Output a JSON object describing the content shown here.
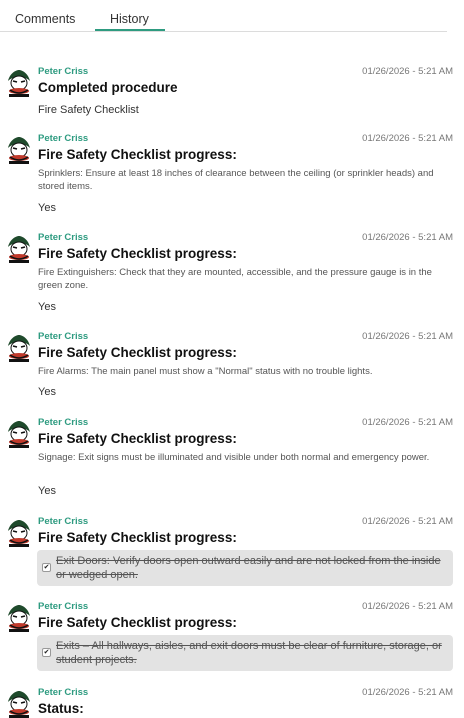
{
  "tabs": {
    "comments": "Comments",
    "history": "History"
  },
  "entries": [
    {
      "author": "Peter Criss",
      "time": "01/26/2026 - 5:21 AM",
      "title": "Completed procedure",
      "subtitle": "Fire Safety Checklist"
    },
    {
      "author": "Peter Criss",
      "time": "01/26/2026 - 5:21 AM",
      "title": "Fire Safety Checklist progress:",
      "detail": "Sprinklers: Ensure at least 18 inches of clearance between the ceiling (or sprinkler heads) and stored items.",
      "answer": "Yes"
    },
    {
      "author": "Peter Criss",
      "time": "01/26/2026 - 5:21 AM",
      "title": "Fire Safety Checklist progress:",
      "detail": "Fire Extinguishers: Check that they are mounted, accessible, and the pressure gauge is in the green zone.",
      "answer": "Yes"
    },
    {
      "author": "Peter Criss",
      "time": "01/26/2026 - 5:21 AM",
      "title": "Fire Safety Checklist progress:",
      "detail": "Fire Alarms: The main panel must show a \"Normal\" status with no trouble lights.",
      "answer": "Yes"
    },
    {
      "author": "Peter Criss",
      "time": "01/26/2026 - 5:21 AM",
      "title": "Fire Safety Checklist progress:",
      "detail": "Signage: Exit signs must be illuminated and visible under both normal and emergency power.",
      "answer": "Yes"
    },
    {
      "author": "Peter Criss",
      "time": "01/26/2026 - 5:21 AM",
      "title": "Fire Safety Checklist progress:",
      "checked_item": "Exit Doors: Verify doors open outward easily and are not locked from the inside or wedged open."
    },
    {
      "author": "Peter Criss",
      "time": "01/26/2026 - 5:21 AM",
      "title": "Fire Safety Checklist progress:",
      "checked_item": "Exits – All hallways, aisles, and exit doors must be clear of furniture, storage, or student projects."
    },
    {
      "author": "Peter Criss",
      "time": "01/26/2026 - 5:21 AM",
      "title": "Status:"
    }
  ],
  "checkbox_glyph": "✔",
  "colors": {
    "accent": "#2e9b80",
    "checked_row_bg": "#e3e3e3"
  },
  "avatar_icon": "kiss-band-logo-icon"
}
